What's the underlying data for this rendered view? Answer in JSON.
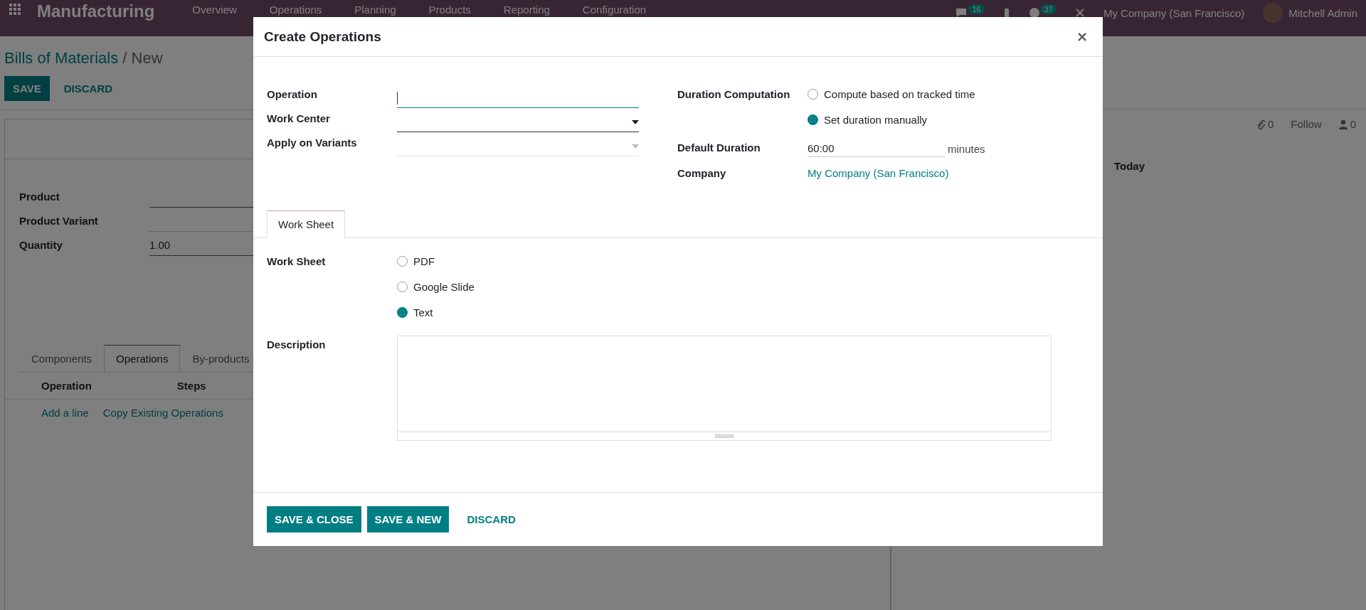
{
  "navbar": {
    "app_name": "Manufacturing",
    "menu": [
      "Overview",
      "Operations",
      "Planning",
      "Products",
      "Reporting",
      "Configuration"
    ],
    "messages_count": "16",
    "activities_count": "37",
    "company": "My Company (San Francisco)",
    "user": "Mitchell Admin"
  },
  "breadcrumb": {
    "parent": "Bills of Materials",
    "separator": "/",
    "current": "New"
  },
  "form_buttons": [
    "SAVE",
    "DISCARD"
  ],
  "form": {
    "fields": [
      {
        "label": "Product"
      },
      {
        "label": "Product Variant"
      },
      {
        "label": "Quantity",
        "value": "1.00"
      }
    ],
    "tabs": [
      {
        "label": "Components",
        "selected": false
      },
      {
        "label": "Operations",
        "selected": true
      },
      {
        "label": "By-products",
        "selected": false
      }
    ],
    "table": {
      "columns": [
        "Operation",
        "Steps"
      ],
      "actions": [
        "Add a line",
        "Copy Existing Operations"
      ]
    }
  },
  "chatter": {
    "attachments": "0",
    "follow": "Follow",
    "followers": "0",
    "date_separator": "Today"
  },
  "dialog": {
    "title": "Create Operations",
    "close": "×",
    "left_fields": [
      {
        "label": "Operation",
        "kind": "text",
        "focused": true
      },
      {
        "label": "Work Center",
        "kind": "select",
        "disabled": false
      },
      {
        "label": "Apply on Variants",
        "kind": "select",
        "disabled": true
      }
    ],
    "duration_computation": {
      "label": "Duration Computation",
      "options": [
        {
          "label": "Compute based on tracked time",
          "selected": false
        },
        {
          "label": "Set duration manually",
          "selected": true
        }
      ]
    },
    "default_duration": {
      "label": "Default Duration",
      "value": "60:00",
      "unit": "minutes"
    },
    "company": {
      "label": "Company",
      "value": "My Company (San Francisco)"
    },
    "tabs": [
      {
        "label": "Work Sheet",
        "selected": true
      }
    ],
    "work_sheet": {
      "label": "Work Sheet",
      "options": [
        {
          "label": "PDF",
          "selected": false
        },
        {
          "label": "Google Slide",
          "selected": false
        },
        {
          "label": "Text",
          "selected": true
        }
      ]
    },
    "description": {
      "label": "Description"
    },
    "buttons": [
      {
        "label": "SAVE & CLOSE",
        "kind": "primary"
      },
      {
        "label": "SAVE & NEW",
        "kind": "primary"
      },
      {
        "label": "DISCARD",
        "kind": "link"
      }
    ]
  }
}
